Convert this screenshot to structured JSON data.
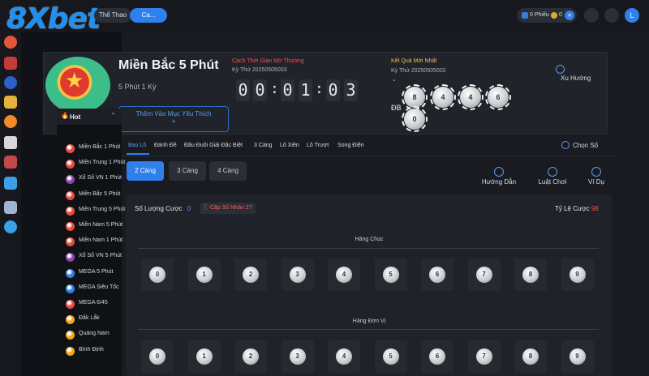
{
  "brand": {
    "logo_text": "8Xbet"
  },
  "topbar": {
    "close_glyph": "✕",
    "tab_sports": "Thể Thao",
    "tab_casino": "Ca...",
    "wallet_tickets": "0 Phiếu",
    "wallet_coins": "0",
    "plus": "+",
    "avatar_letter": "L"
  },
  "game": {
    "title": "Miền Bắc 5 Phút",
    "subtitle": "5 Phút 1 Kỳ",
    "fav_label": "Thêm Vào Mục Yêu Thích",
    "fav_plus": "+",
    "countdown_title": "Cách Thời Gian Mở Thưởng",
    "countdown_period": "Kỳ Thứ 20250505003",
    "timer_digits": [
      "0",
      "0",
      "0",
      "1",
      "0",
      "3"
    ],
    "timer_colon": ":",
    "latest_title": "Kết Quả Mới Nhất",
    "latest_period": "Kỳ Thứ 20250505002",
    "db_label": "ĐB",
    "trend_label": "Xu Hướng",
    "result_balls": [
      "8",
      "4",
      "4",
      "6",
      "0"
    ]
  },
  "side_menu": {
    "hot_label": "Hot",
    "items": [
      {
        "label": "Miền Bắc 1 Phút",
        "color": "#e94b3c"
      },
      {
        "label": "Miền Trung 1 Phút",
        "color": "#e94b3c"
      },
      {
        "label": "Xổ Số VN 1 Phút",
        "color": "#8e44ad"
      },
      {
        "label": "Miền Bắc 5 Phút",
        "color": "#e94b3c"
      },
      {
        "label": "Miền Trung 5 Phút",
        "color": "#e94b3c"
      },
      {
        "label": "Miền Nam 5 Phút",
        "color": "#e94b3c"
      },
      {
        "label": "Miền Nam 1 Phút",
        "color": "#e94b3c"
      },
      {
        "label": "Xổ Số VN 5 Phút",
        "color": "#8e44ad"
      },
      {
        "label": "MEGA 5 Phút",
        "color": "#2f80ed"
      },
      {
        "label": "MEGA Siêu Tốc",
        "color": "#2f80ed"
      },
      {
        "label": "MEGA 6/45",
        "color": "#e94b3c"
      },
      {
        "label": "Đắk Lắk",
        "color": "#f2a71b"
      },
      {
        "label": "Quảng Nam",
        "color": "#f2a71b"
      },
      {
        "label": "Bình Định",
        "color": "#f2a71b"
      }
    ]
  },
  "bet_tabs": {
    "items": [
      "Bao Lô",
      "Đánh Đề",
      "Đầu Đuôi Giải Đặc Biệt",
      "3 Càng",
      "Lô Xiên",
      "Lô Trượt",
      "Song Điện"
    ],
    "active_index": 0,
    "choose_label": "Chọn Số"
  },
  "cang": {
    "items": [
      "2 Càng",
      "3 Càng",
      "4 Càng"
    ],
    "active_index": 0
  },
  "help": {
    "guide": "Hướng Dẫn",
    "rules": "Luật Chơi",
    "example": "Ví Dụ"
  },
  "panel": {
    "bet_count_label": "Số Lượng Cược",
    "bet_count_value": "0",
    "pair_label": "Cặp Số Nhân 27",
    "ratio_label": "Tỷ Lệ Cược",
    "ratio_value": "98",
    "tens_title": "Hàng Chục",
    "units_title": "Hàng Đơn Vị",
    "digits": [
      "0",
      "1",
      "2",
      "3",
      "4",
      "5",
      "6",
      "7",
      "8",
      "9"
    ]
  },
  "colors": {
    "accent": "#2f80ed",
    "red": "#ff4d4d",
    "gold": "#f0c050",
    "bg": "#101217"
  }
}
